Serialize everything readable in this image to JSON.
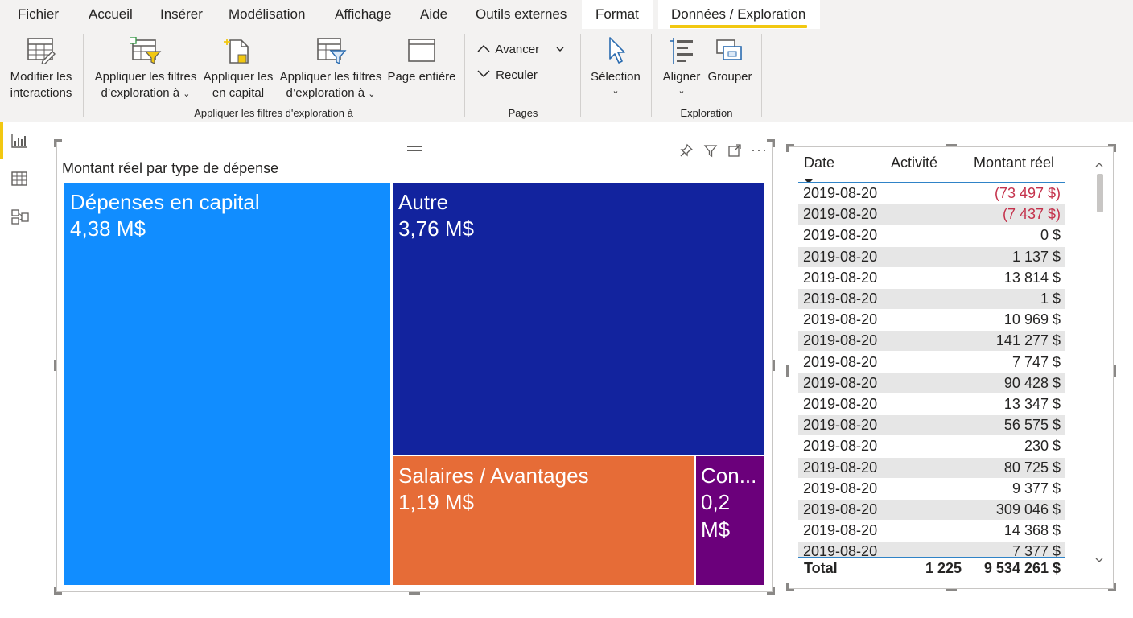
{
  "menu": {
    "items": [
      {
        "label": "Fichier"
      },
      {
        "label": "Accueil"
      },
      {
        "label": "Insérer"
      },
      {
        "label": "Modélisation"
      },
      {
        "label": "Affichage"
      },
      {
        "label": "Aide"
      },
      {
        "label": "Outils externes"
      },
      {
        "label": "Format"
      },
      {
        "label": "Données / Exploration"
      }
    ]
  },
  "ribbon": {
    "edit_interactions": {
      "line1": "Modifier les",
      "line2": "interactions"
    },
    "drill_filters_1": {
      "line1": "Appliquer les filtres",
      "line2": "d’exploration à"
    },
    "capital": {
      "line1": "Appliquer les",
      "line2": "en capital"
    },
    "drill_filters_2": {
      "line1": "Appliquer les filtres",
      "line2": "d’exploration à"
    },
    "full_page": {
      "line1": "Page entière"
    },
    "group_filters": "Appliquer les filtres d'exploration à",
    "forward": "Avancer",
    "backward": "Reculer",
    "group_pages": "Pages",
    "selection": "Sélection",
    "align": "Aligner",
    "group": "Grouper",
    "group_exploration": "Exploration"
  },
  "treemap": {
    "title": "Montant réel par type de dépense",
    "tiles": [
      {
        "name": "Dépenses en capital",
        "value": "4,38 M$",
        "color": "#118dff"
      },
      {
        "name": "Autre",
        "value": "3,76 M$",
        "color": "#12239e"
      },
      {
        "name": "Salaires / Avantages",
        "value": "1,19 M$",
        "color": "#e66c37"
      },
      {
        "name": "Con...",
        "value": "0,2",
        "value2": "M$",
        "color": "#6b007b"
      }
    ]
  },
  "table": {
    "headers": {
      "date": "Date",
      "activity": "Activité",
      "amount": "Montant réel"
    },
    "rows": [
      {
        "date": "2019-08-20",
        "amount": "(73 497 $)",
        "negative": true
      },
      {
        "date": "2019-08-20",
        "amount": "(7 437 $)",
        "negative": true
      },
      {
        "date": "2019-08-20",
        "amount": "0 $"
      },
      {
        "date": "2019-08-20",
        "amount": "1 137 $"
      },
      {
        "date": "2019-08-20",
        "amount": "13 814 $"
      },
      {
        "date": "2019-08-20",
        "amount": "1 $"
      },
      {
        "date": "2019-08-20",
        "amount": "10 969 $"
      },
      {
        "date": "2019-08-20",
        "amount": "141 277 $"
      },
      {
        "date": "2019-08-20",
        "amount": "7 747 $"
      },
      {
        "date": "2019-08-20",
        "amount": "90 428 $"
      },
      {
        "date": "2019-08-20",
        "amount": "13 347 $"
      },
      {
        "date": "2019-08-20",
        "amount": "56 575 $"
      },
      {
        "date": "2019-08-20",
        "amount": "230 $"
      },
      {
        "date": "2019-08-20",
        "amount": "80 725 $"
      },
      {
        "date": "2019-08-20",
        "amount": "9 377 $"
      },
      {
        "date": "2019-08-20",
        "amount": "309 046 $"
      },
      {
        "date": "2019-08-20",
        "amount": "14 368 $"
      },
      {
        "date": "2019-08-20",
        "amount": "7 377 $"
      }
    ],
    "total": {
      "label": "Total",
      "activity": "1 225",
      "amount": "9 534 261 $"
    }
  },
  "colors": {
    "accent": "#f2c811",
    "negative": "#c4314b",
    "table_line": "#2f83c7"
  }
}
